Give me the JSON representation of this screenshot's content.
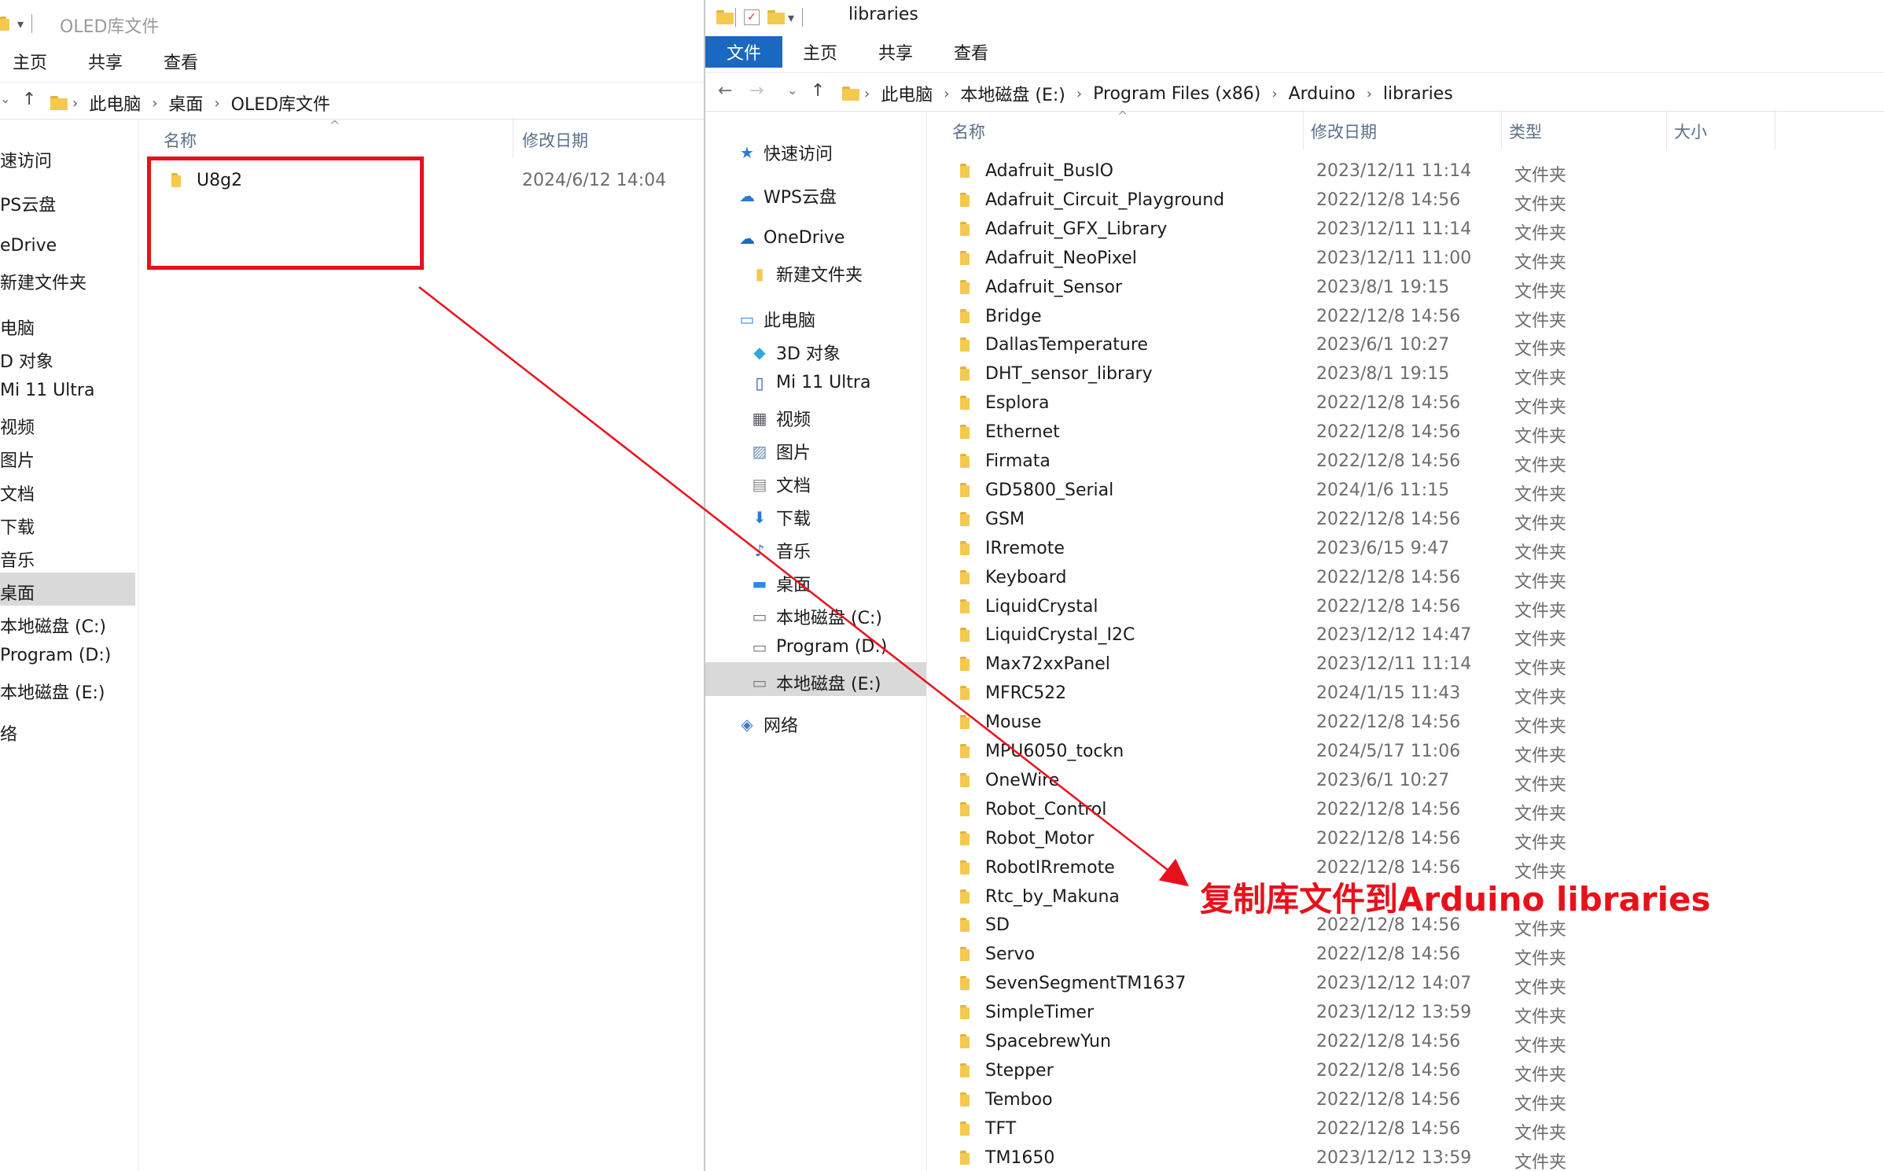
{
  "left_window": {
    "title": "OLED库文件",
    "tabs": [
      "主页",
      "共享",
      "查看"
    ],
    "breadcrumbs": [
      "此电脑",
      "桌面",
      "OLED库文件"
    ],
    "sidebar": [
      "速访问",
      "PS云盘",
      "eDrive",
      "新建文件夹",
      "电脑",
      "D 对象",
      "Mi 11 Ultra",
      "视频",
      "图片",
      "文档",
      "下载",
      "音乐",
      "桌面",
      "本地磁盘 (C:)",
      "Program (D:)",
      "本地磁盘 (E:)",
      "络"
    ],
    "columns": {
      "name": "名称",
      "modified": "修改日期"
    },
    "files": [
      {
        "name": "U8g2",
        "date": "2024/6/12 14:04"
      }
    ]
  },
  "right_window": {
    "title": "libraries",
    "tabs": [
      "文件",
      "主页",
      "共享",
      "查看"
    ],
    "breadcrumbs": [
      "此电脑",
      "本地磁盘 (E:)",
      "Program Files (x86)",
      "Arduino",
      "libraries"
    ],
    "sidebar": [
      "快速访问",
      "WPS云盘",
      "OneDrive",
      "新建文件夹",
      "此电脑",
      "3D 对象",
      "Mi 11 Ultra",
      "视频",
      "图片",
      "文档",
      "下载",
      "音乐",
      "桌面",
      "本地磁盘 (C:)",
      "Program (D:)",
      "本地磁盘 (E:)",
      "网络"
    ],
    "columns": {
      "name": "名称",
      "modified": "修改日期",
      "type": "类型",
      "size": "大小"
    },
    "files": [
      {
        "name": "Adafruit_BusIO",
        "date": "2023/12/11 11:14",
        "type": "文件夹"
      },
      {
        "name": "Adafruit_Circuit_Playground",
        "date": "2022/12/8 14:56",
        "type": "文件夹"
      },
      {
        "name": "Adafruit_GFX_Library",
        "date": "2023/12/11 11:14",
        "type": "文件夹"
      },
      {
        "name": "Adafruit_NeoPixel",
        "date": "2023/12/11 11:00",
        "type": "文件夹"
      },
      {
        "name": "Adafruit_Sensor",
        "date": "2023/8/1 19:15",
        "type": "文件夹"
      },
      {
        "name": "Bridge",
        "date": "2022/12/8 14:56",
        "type": "文件夹"
      },
      {
        "name": "DallasTemperature",
        "date": "2023/6/1 10:27",
        "type": "文件夹"
      },
      {
        "name": "DHT_sensor_library",
        "date": "2023/8/1 19:15",
        "type": "文件夹"
      },
      {
        "name": "Esplora",
        "date": "2022/12/8 14:56",
        "type": "文件夹"
      },
      {
        "name": "Ethernet",
        "date": "2022/12/8 14:56",
        "type": "文件夹"
      },
      {
        "name": "Firmata",
        "date": "2022/12/8 14:56",
        "type": "文件夹"
      },
      {
        "name": "GD5800_Serial",
        "date": "2024/1/6 11:15",
        "type": "文件夹"
      },
      {
        "name": "GSM",
        "date": "2022/12/8 14:56",
        "type": "文件夹"
      },
      {
        "name": "IRremote",
        "date": "2023/6/15 9:47",
        "type": "文件夹"
      },
      {
        "name": "Keyboard",
        "date": "2022/12/8 14:56",
        "type": "文件夹"
      },
      {
        "name": "LiquidCrystal",
        "date": "2022/12/8 14:56",
        "type": "文件夹"
      },
      {
        "name": "LiquidCrystal_I2C",
        "date": "2023/12/12 14:47",
        "type": "文件夹"
      },
      {
        "name": "Max72xxPanel",
        "date": "2023/12/11 11:14",
        "type": "文件夹"
      },
      {
        "name": "MFRC522",
        "date": "2024/1/15 11:43",
        "type": "文件夹"
      },
      {
        "name": "Mouse",
        "date": "2022/12/8 14:56",
        "type": "文件夹"
      },
      {
        "name": "MPU6050_tockn",
        "date": "2024/5/17 11:06",
        "type": "文件夹"
      },
      {
        "name": "OneWire",
        "date": "2023/6/1 10:27",
        "type": "文件夹"
      },
      {
        "name": "Robot_Control",
        "date": "2022/12/8 14:56",
        "type": "文件夹"
      },
      {
        "name": "Robot_Motor",
        "date": "2022/12/8 14:56",
        "type": "文件夹"
      },
      {
        "name": "RobotIRremote",
        "date": "2022/12/8 14:56",
        "type": "文件夹"
      },
      {
        "name": "Rtc_by_Makuna",
        "date": "",
        "type": ""
      },
      {
        "name": "SD",
        "date": "2022/12/8 14:56",
        "type": "文件夹"
      },
      {
        "name": "Servo",
        "date": "2022/12/8 14:56",
        "type": "文件夹"
      },
      {
        "name": "SevenSegmentTM1637",
        "date": "2023/12/12 14:07",
        "type": "文件夹"
      },
      {
        "name": "SimpleTimer",
        "date": "2023/12/12 13:59",
        "type": "文件夹"
      },
      {
        "name": "SpacebrewYun",
        "date": "2022/12/8 14:56",
        "type": "文件夹"
      },
      {
        "name": "Stepper",
        "date": "2022/12/8 14:56",
        "type": "文件夹"
      },
      {
        "name": "Temboo",
        "date": "2022/12/8 14:56",
        "type": "文件夹"
      },
      {
        "name": "TFT",
        "date": "2022/12/8 14:56",
        "type": "文件夹"
      },
      {
        "name": "TM1650",
        "date": "2023/12/12 13:59",
        "type": "文件夹"
      }
    ]
  },
  "annotation": "复制库文件到Arduino libraries",
  "colors": {
    "accent": "#1a68c0",
    "annotation": "#e8111b",
    "folder": "#f4c950",
    "selection": "#d9d9d9"
  }
}
